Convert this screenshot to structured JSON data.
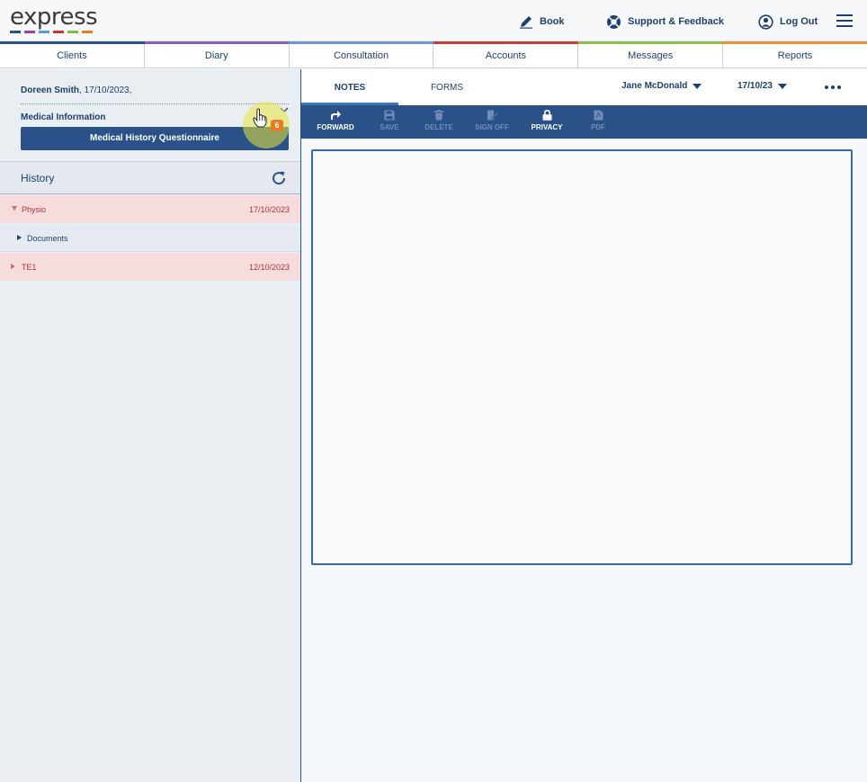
{
  "header": {
    "logo_text": "express",
    "logo_colors": [
      "#2a5289",
      "#8e44ad",
      "#5b9bd5",
      "#c0392b",
      "#7fbf3f",
      "#e67e22"
    ],
    "book_label": "Book",
    "support_label": "Support & Feedback",
    "logout_label": "Log Out"
  },
  "strip_colors": [
    "#2a5289",
    "#8e5fb4",
    "#6e96cf",
    "#c0403a",
    "#8dc04f",
    "#e8903a"
  ],
  "nav": {
    "tabs": [
      "Clients",
      "Diary",
      "Consultation",
      "Accounts",
      "Messages",
      "Reports"
    ]
  },
  "patient": {
    "name": "Doreen Smith",
    "date": ", 17/10/2023,",
    "medical_info_label": "Medical Information",
    "questionnaire_label": "Medical History Questionnaire",
    "badge_count": "6"
  },
  "history": {
    "title": "History",
    "rows": [
      {
        "label": "Physio",
        "date": "17/10/2023"
      },
      {
        "label": "Documents",
        "date": ""
      },
      {
        "label": "TE1",
        "date": "12/10/2023"
      }
    ]
  },
  "right": {
    "tabs": [
      "NOTES",
      "FORMS"
    ],
    "practitioner": "Jane McDonald",
    "date_select": "17/10/23"
  },
  "toolbar": {
    "forward": "FORWARD",
    "save": "SAVE",
    "delete": "DELETE",
    "sign_off": "SIGN OFF",
    "privacy": "PRIVACY",
    "pdf": "PDF"
  }
}
